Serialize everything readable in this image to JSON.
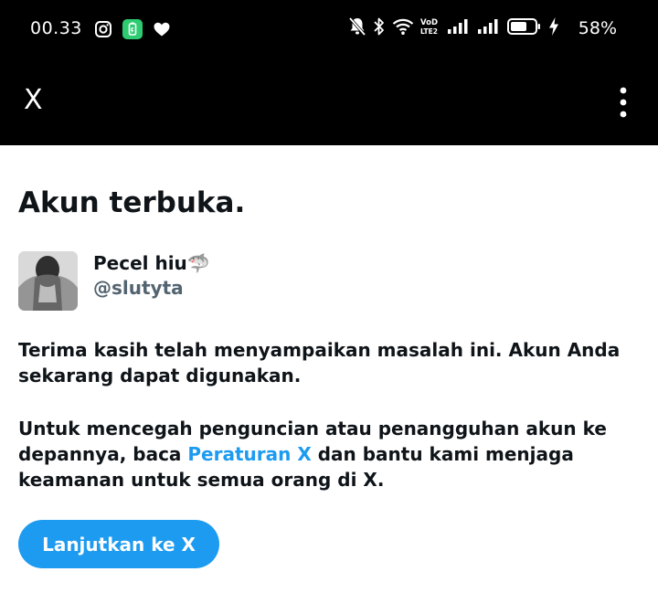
{
  "status_bar": {
    "time": "00.33",
    "battery_pct": "58%",
    "network_label": "VoD LTE2"
  },
  "app_bar": {
    "close_label": "X"
  },
  "page": {
    "title": "Akun terbuka."
  },
  "account": {
    "name": "Pecel hiu🦈",
    "handle": "@slutyta"
  },
  "message": {
    "p1": "Terima kasih telah menyampaikan masalah ini. Akun Anda sekarang dapat digunakan.",
    "p2_before": "Untuk mencegah penguncian atau penangguhan akun ke depannya, baca ",
    "p2_link": "Peraturan X",
    "p2_after": " dan bantu kami menjaga keamanan untuk semua orang di X."
  },
  "actions": {
    "continue_label": "Lanjutkan ke X"
  },
  "colors": {
    "accent": "#1d9bf0",
    "handle": "#536471",
    "text": "#0f1419",
    "bar": "#000000"
  }
}
